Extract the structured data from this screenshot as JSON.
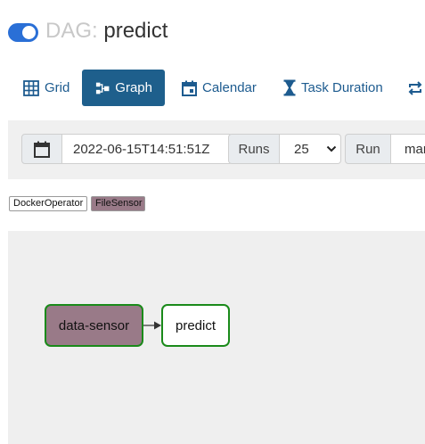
{
  "header": {
    "toggle_on": true,
    "dag_prefix": "DAG:",
    "dag_name": "predict"
  },
  "tabs": [
    {
      "label": "Grid",
      "icon": "grid-icon",
      "active": false
    },
    {
      "label": "Graph",
      "icon": "graph-icon",
      "active": true
    },
    {
      "label": "Calendar",
      "icon": "calendar-icon",
      "active": false
    },
    {
      "label": "Task Duration",
      "icon": "hourglass-icon",
      "active": false
    },
    {
      "label": "",
      "icon": "retries-icon",
      "active": false
    }
  ],
  "filters": {
    "date_icon": "calendar-icon",
    "base_date": "2022-06-15T14:51:51Z",
    "runs_label": "Runs",
    "runs_value": "25",
    "run_label": "Run",
    "run_value": "mar"
  },
  "legend": [
    {
      "label": "DockerOperator",
      "color": "#ffffff"
    },
    {
      "label": "FileSensor",
      "color": "#997a88"
    }
  ],
  "graph": {
    "nodes": [
      {
        "label": "data-sensor",
        "fill": "#997a88",
        "border": "#1a8a1a"
      },
      {
        "label": "predict",
        "fill": "#ffffff",
        "border": "#1a8a1a"
      }
    ],
    "edges": [
      {
        "from": "data-sensor",
        "to": "predict"
      }
    ]
  },
  "colors": {
    "accent": "#1e5f8c",
    "toggle": "#2a6fd6",
    "success_border": "#1a8a1a",
    "file_sensor": "#997a88"
  }
}
